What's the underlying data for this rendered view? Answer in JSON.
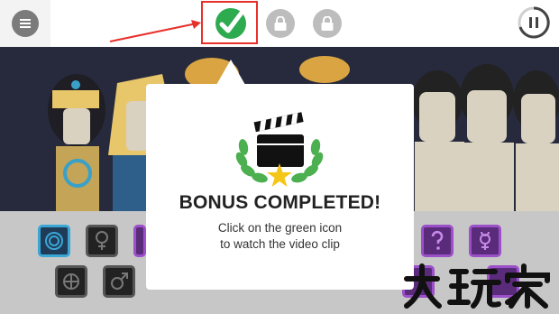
{
  "topbar": {
    "menu_icon": "hamburger-icon",
    "bonus_icon": "green-check-icon",
    "locked_icons": [
      "lock-icon",
      "lock-icon"
    ],
    "pause_icon": "pause-icon",
    "highlight_color": "#e8302b"
  },
  "modal": {
    "title": "BONUS COMPLETED!",
    "line1": "Click on the green icon",
    "line2": "to watch the video clip",
    "icon": "clapperboard-icon",
    "wreath_color": "#4caf50",
    "star_color": "#f5c518"
  },
  "watermark": {
    "text": "大玩家"
  }
}
